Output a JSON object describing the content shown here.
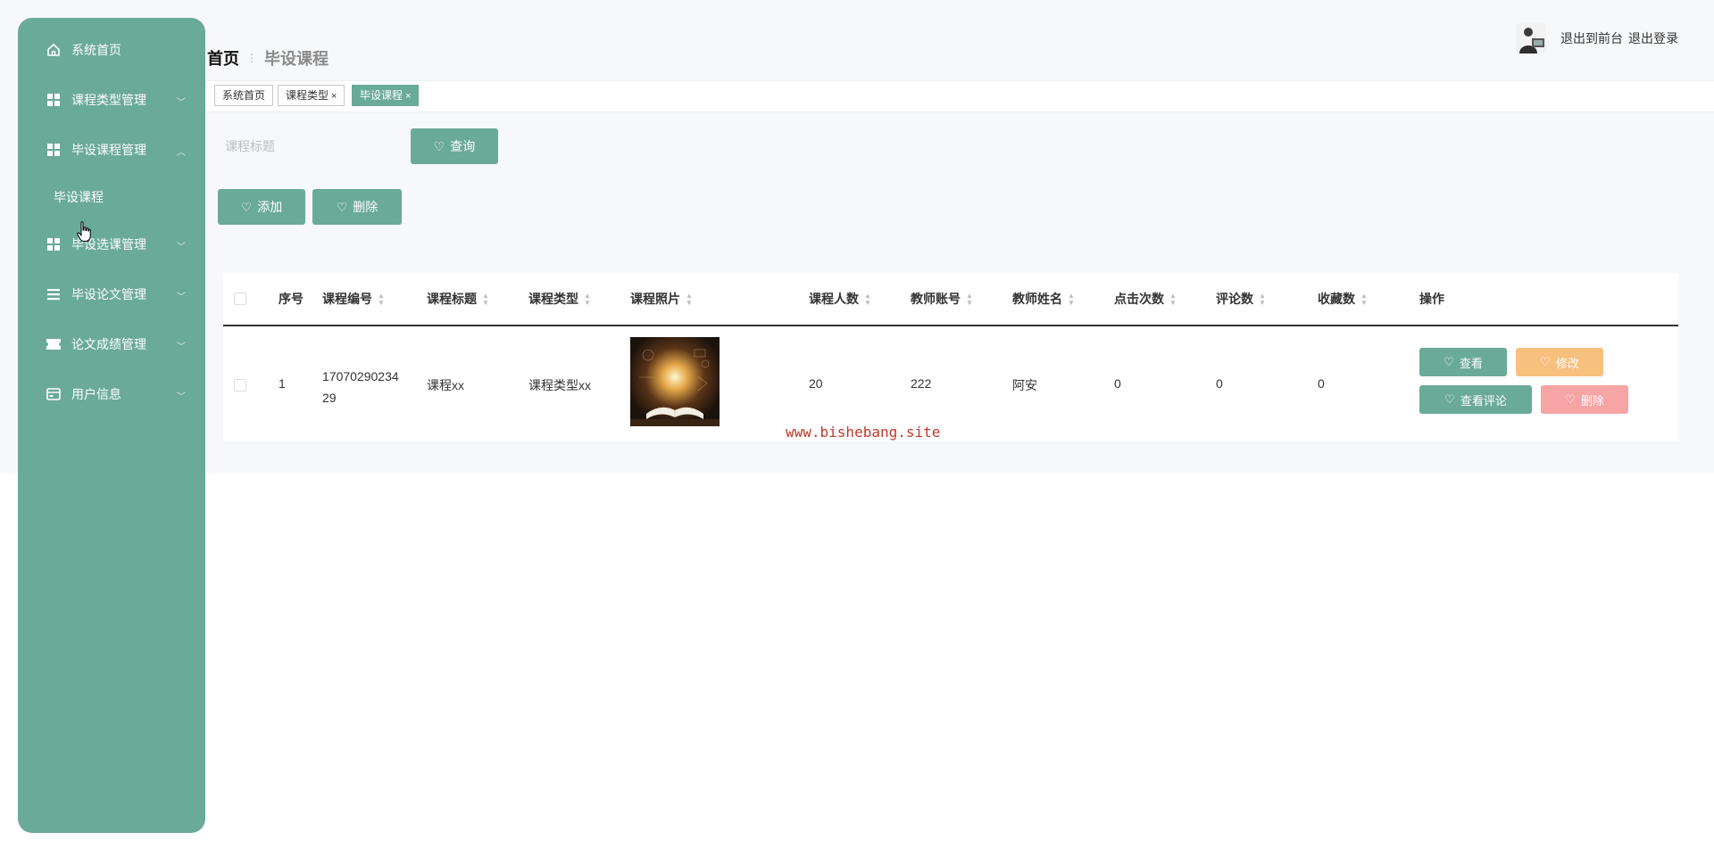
{
  "sidebar": {
    "items": [
      {
        "label": "系统首页",
        "icon": "home-icon"
      },
      {
        "label": "课程类型管理",
        "icon": "grid-icon"
      },
      {
        "label": "毕设课程管理",
        "icon": "grid-icon",
        "expanded": true
      },
      {
        "label": "毕设选课管理",
        "icon": "grid-icon"
      },
      {
        "label": "毕设论文管理",
        "icon": "list-icon"
      },
      {
        "label": "论文成绩管理",
        "icon": "ticket-icon"
      },
      {
        "label": "用户信息",
        "icon": "card-icon"
      }
    ],
    "sub_item": "毕设课程"
  },
  "breadcrumb": {
    "home": "首页",
    "current": "毕设课程"
  },
  "user": {
    "front_link": "退出到前台",
    "logout_link": "退出登录"
  },
  "tags": [
    {
      "label": "系统首页",
      "closable": false
    },
    {
      "label": "课程类型",
      "closable": true
    },
    {
      "label": "毕设课程",
      "closable": true
    }
  ],
  "tag_close_glyph": "×",
  "search": {
    "placeholder": "课程标题",
    "button": "查询"
  },
  "actions": {
    "add": "添加",
    "delete": "删除"
  },
  "table": {
    "columns": [
      "序号",
      "课程编号",
      "课程标题",
      "课程类型",
      "课程照片",
      "课程人数",
      "教师账号",
      "教师姓名",
      "点击次数",
      "评论数",
      "收藏数",
      "操作"
    ],
    "rows": [
      {
        "index": "1",
        "code_line1": "17070290234",
        "code_line2": "29",
        "title": "课程xx",
        "type": "课程类型xx",
        "count": "20",
        "teacher_account": "222",
        "teacher_name": "阿安",
        "clicks": "0",
        "comments": "0",
        "favorites": "0",
        "ops": {
          "view": "查看",
          "edit": "修改",
          "view_comments": "查看评论",
          "delete": "删除"
        }
      }
    ]
  },
  "watermark": "www.bishebang.site",
  "colors": {
    "primary": "#6aaa98",
    "warning": "#f8c07e",
    "danger": "#f7a4a4",
    "watermark": "#c0392b"
  }
}
